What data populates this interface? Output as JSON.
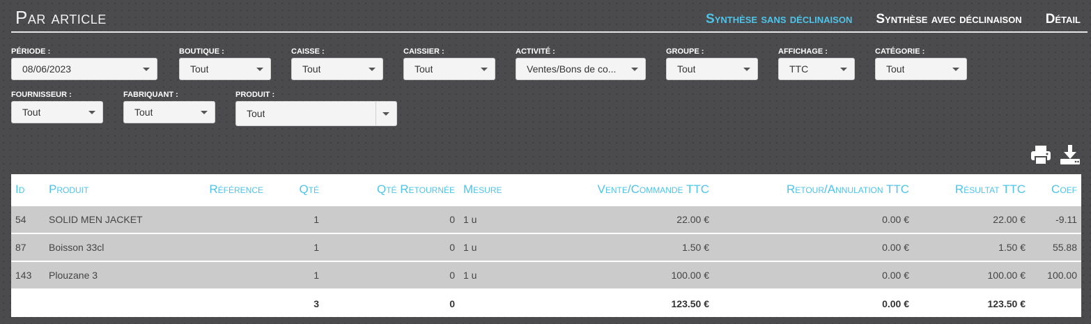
{
  "header": {
    "title": "Par article",
    "tabs": [
      {
        "label": "Synthèse sans déclinaison",
        "active": true
      },
      {
        "label": "Synthèse avec déclinaison",
        "active": false
      },
      {
        "label": "Détail",
        "active": false
      }
    ]
  },
  "filters": {
    "periode": {
      "label": "Période :",
      "value": "08/06/2023"
    },
    "boutique": {
      "label": "Boutique :",
      "value": "Tout"
    },
    "caisse": {
      "label": "Caisse :",
      "value": "Tout"
    },
    "caissier": {
      "label": "Caissier :",
      "value": "Tout"
    },
    "activite": {
      "label": "Activité :",
      "value": "Ventes/Bons de co..."
    },
    "groupe": {
      "label": "Groupe :",
      "value": "Tout"
    },
    "affichage": {
      "label": "Affichage :",
      "value": "TTC"
    },
    "categorie": {
      "label": "Catégorie :",
      "value": "Tout"
    },
    "fournisseur": {
      "label": "Fournisseur :",
      "value": "Tout"
    },
    "fabriquant": {
      "label": "Fabriquant :",
      "value": "Tout"
    },
    "produit": {
      "label": "Produit :",
      "value": "Tout"
    }
  },
  "tools": {
    "print_icon": "print-icon",
    "download_icon": "download-icon"
  },
  "colors": {
    "accent": "#4fc3e8",
    "background": "#4b4b4d",
    "row": "#cbcbcb"
  },
  "table": {
    "columns": [
      "Id",
      "Produit",
      "Référence",
      "Qté",
      "Qté Retournée",
      "Mesure",
      "Vente/Commande TTC",
      "Retour/Annulation TTC",
      "Résultat TTC",
      "Coef"
    ],
    "rows": [
      [
        "54",
        "SOLID MEN JACKET",
        "",
        "1",
        "0",
        "1 u",
        "22.00 €",
        "0.00 €",
        "22.00 €",
        "-9.11"
      ],
      [
        "87",
        "Boisson 33cl",
        "",
        "1",
        "0",
        "1 u",
        "1.50 €",
        "0.00 €",
        "1.50 €",
        "55.88"
      ],
      [
        "143",
        "Plouzane 3",
        "",
        "1",
        "0",
        "1 u",
        "100.00 €",
        "0.00 €",
        "100.00 €",
        "100.00"
      ]
    ],
    "totals": [
      "",
      "",
      "",
      "3",
      "0",
      "",
      "123.50 €",
      "0.00 €",
      "123.50 €",
      ""
    ]
  }
}
